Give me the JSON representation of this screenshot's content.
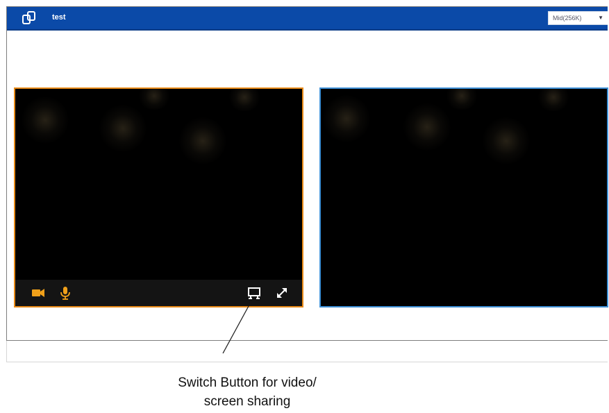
{
  "header": {
    "title": "test",
    "quality_selected": "Mid(256K)",
    "logo_icon": "app-logo-icon",
    "accent_color": "#0b4aa8"
  },
  "local_video": {
    "border_color": "#e98a17",
    "controls": [
      {
        "name": "camera-icon"
      },
      {
        "name": "microphone-icon"
      },
      {
        "name": "screen-share-switch-icon"
      },
      {
        "name": "fullscreen-icon"
      }
    ]
  },
  "remote_video": {
    "border_color": "#3d8fd6"
  },
  "annotation": {
    "line1": "Switch Button for video/",
    "line2": "screen sharing"
  }
}
